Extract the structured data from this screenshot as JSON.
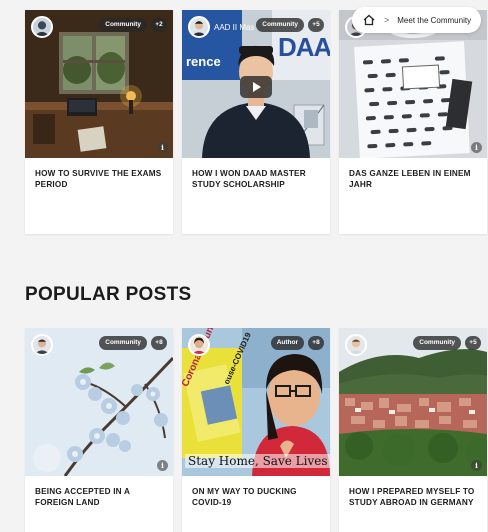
{
  "breadcrumb": {
    "separator": ">",
    "current": "Meet the Community"
  },
  "top_posts": [
    {
      "badge": "Community",
      "count": "+2",
      "title": "HOW TO SURVIVE THE EXAMS PERIOD"
    },
    {
      "badge": "Community",
      "count": "+5",
      "title": "HOW I WON DAAD MASTER STUDY SCHOLARSHIP",
      "overlay": "DAAD",
      "overlay_small": "AAD II Mas",
      "overlay_blue": "rence"
    },
    {
      "badge": "",
      "count": "",
      "title": "DAS GANZE LEBEN IN EINEM JAHR"
    }
  ],
  "section": {
    "title": "POPULAR POSTS"
  },
  "popular_posts": [
    {
      "badge": "Community",
      "count": "+8",
      "title": "BEING ACCEPTED IN A FOREIGN LAND"
    },
    {
      "badge": "Author",
      "count": "+8",
      "title": "ON MY WAY TO DUCKING COVID-19",
      "caption": "Stay Home, Save Lives",
      "sign_text": "Corona Voluntee",
      "sign_text2": "ouse-COVID19"
    },
    {
      "badge": "Community",
      "count": "+5",
      "title": "HOW I PREPARED MYSELF TO STUDY ABROAD IN GERMANY"
    }
  ],
  "info_glyph": "i"
}
